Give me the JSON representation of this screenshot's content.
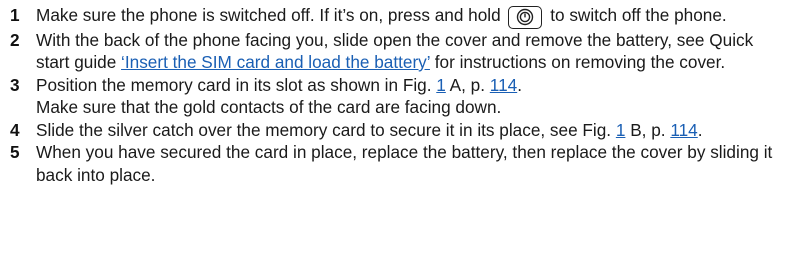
{
  "steps": [
    {
      "number": "1",
      "text_before": "Make sure the phone is switched off. If it’s on, press and hold",
      "key_icon": "power-key-icon",
      "text_after": "to switch off the phone."
    },
    {
      "number": "2",
      "text_before": "With the back of the phone facing you, slide open the cover and remove the battery, see Quick start guide",
      "link": "‘Insert the SIM card and load the battery’",
      "text_after": "for instructions on removing the cover."
    },
    {
      "number": "3",
      "text_before": "Position the memory card in its slot as shown in Fig.",
      "fig_link": "1",
      "text_mid": "A, p.",
      "page_link": "114",
      "text_end": ".",
      "line2": "Make sure that the gold contacts of the card are facing down."
    },
    {
      "number": "4",
      "text_before": "Slide the silver catch over the memory card to secure it in its place, see Fig.",
      "fig_link": "1",
      "text_mid": "B, p.",
      "page_link": "114",
      "text_end": "."
    },
    {
      "number": "5",
      "text": "When you have secured the card in place, replace the battery, then replace the cover by sliding it back into place."
    }
  ],
  "colors": {
    "link": "#1a5fb4",
    "text": "#1a1a1a"
  }
}
